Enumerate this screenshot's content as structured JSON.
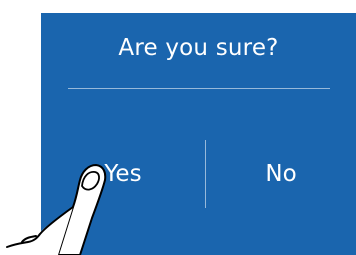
{
  "dialog": {
    "title": "Are you sure?",
    "background_color": "#1a65ae",
    "text_color": "#ffffff",
    "yes_label": "Yes",
    "no_label": "No"
  },
  "overlay": {
    "icon": "pointing-finger-icon",
    "target": "yes"
  }
}
